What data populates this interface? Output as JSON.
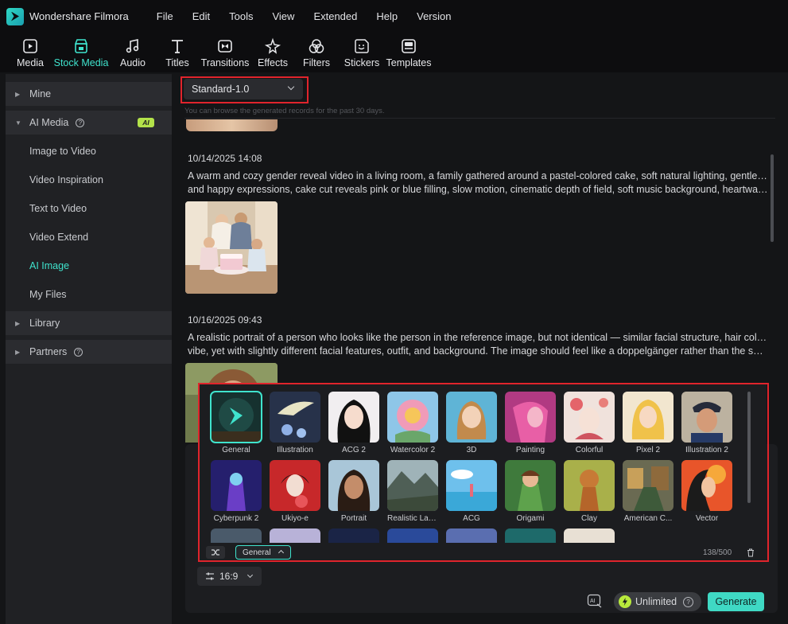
{
  "app": {
    "title": "Wondershare Filmora"
  },
  "menu": [
    "File",
    "Edit",
    "Tools",
    "View",
    "Extended",
    "Help",
    "Version"
  ],
  "toolbar": [
    {
      "label": "Media",
      "icon": "media-icon",
      "active": false
    },
    {
      "label": "Stock Media",
      "icon": "stock-media-icon",
      "active": true
    },
    {
      "label": "Audio",
      "icon": "audio-icon",
      "active": false
    },
    {
      "label": "Titles",
      "icon": "titles-icon",
      "active": false
    },
    {
      "label": "Transitions",
      "icon": "transitions-icon",
      "active": false
    },
    {
      "label": "Effects",
      "icon": "effects-icon",
      "active": false
    },
    {
      "label": "Filters",
      "icon": "filters-icon",
      "active": false
    },
    {
      "label": "Stickers",
      "icon": "stickers-icon",
      "active": false
    },
    {
      "label": "Templates",
      "icon": "templates-icon",
      "active": false
    }
  ],
  "sidebar": {
    "mine": "Mine",
    "ai_media": "AI Media",
    "ai_badge": "AI",
    "sub_items": [
      "Image to Video",
      "Video Inspiration",
      "Text to Video",
      "Video Extend",
      "AI Image",
      "My Files"
    ],
    "active_sub": "AI Image",
    "library": "Library",
    "partners": "Partners"
  },
  "model_select": {
    "value": "Standard-1.0"
  },
  "browse_note": "You can browse the generated records for the past 30 days.",
  "records": [
    {
      "time": "10/14/2025 14:08",
      "line1": "A warm and cozy gender reveal video in a living room, a family gathered around a pastel-colored cake, soft natural lighting, gentle smiles",
      "line2": "and happy expressions, cake cut reveals pink or blue filling, slow motion, cinematic depth of field, soft music background, heartwarmi..."
    },
    {
      "time": "10/16/2025 09:43",
      "line1": "A realistic portrait of a person who looks like the person in the reference image, but not identical — similar facial structure, hair color, and",
      "line2": "vibe, yet with slightly different facial features, outfit, and background. The image should feel like a doppelgänger rather than the same ..."
    }
  ],
  "styles_row1": [
    "General",
    "Illustration",
    "ACG 2",
    "Watercolor 2",
    "3D",
    "Painting",
    "Colorful",
    "Pixel 2",
    "Illustration 2"
  ],
  "styles_row2": [
    "Cyberpunk 2",
    "Ukiyo-e",
    "Portrait",
    "Realistic Lan...",
    "ACG",
    "Origami",
    "Clay",
    "American C...",
    "Vector"
  ],
  "style_chip": "General",
  "prompt_counter": "138/500",
  "aspect_ratio": "16:9",
  "credits": "Unlimited",
  "generate_label": "Generate",
  "colors": {
    "accent": "#3fe3cd",
    "highlight_box": "#e0242c",
    "ai_badge": "#b3e24a"
  }
}
